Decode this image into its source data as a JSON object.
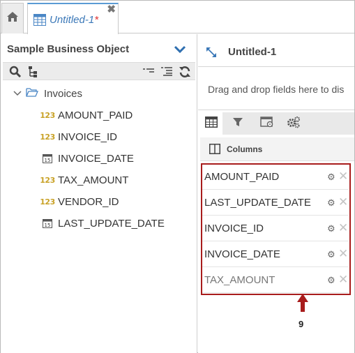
{
  "tabs": {
    "home_icon": "home-icon",
    "doc_title": "Untitled-1",
    "doc_modified": "*",
    "close_glyph": "✖"
  },
  "left_panel": {
    "title": "Sample Business Object",
    "toolbar_icons": [
      "search-icon",
      "tree-view-icon",
      "collapse-all-icon",
      "expand-all-icon",
      "refresh-icon"
    ],
    "tree": {
      "root_label": "Invoices",
      "items": [
        {
          "label": "AMOUNT_PAID",
          "type": "number"
        },
        {
          "label": "INVOICE_ID",
          "type": "number"
        },
        {
          "label": "INVOICE_DATE",
          "type": "date"
        },
        {
          "label": "TAX_AMOUNT",
          "type": "number"
        },
        {
          "label": "VENDOR_ID",
          "type": "number"
        },
        {
          "label": "LAST_UPDATE_DATE",
          "type": "date"
        }
      ],
      "number_icon_text": "123",
      "date_icon_text": "15"
    }
  },
  "right_panel": {
    "title": "Untitled-1",
    "drop_hint": "Drag and drop fields here to dis",
    "tab_icons": [
      "table-icon",
      "filter-icon",
      "settings-window-icon",
      "gears-icon"
    ],
    "columns_label": "Columns",
    "columns": [
      {
        "name": "AMOUNT_PAID"
      },
      {
        "name": "LAST_UPDATE_DATE"
      },
      {
        "name": "INVOICE_ID"
      },
      {
        "name": "INVOICE_DATE"
      },
      {
        "name": "TAX_AMOUNT"
      }
    ],
    "gear_glyph": "⚙",
    "remove_glyph": "✕"
  },
  "annotation": {
    "callout_number": "9",
    "highlight_color": "#a81c1c"
  },
  "colors": {
    "accent": "#3b78b8",
    "number_type": "#c9a227",
    "modified_star": "#e03030"
  }
}
